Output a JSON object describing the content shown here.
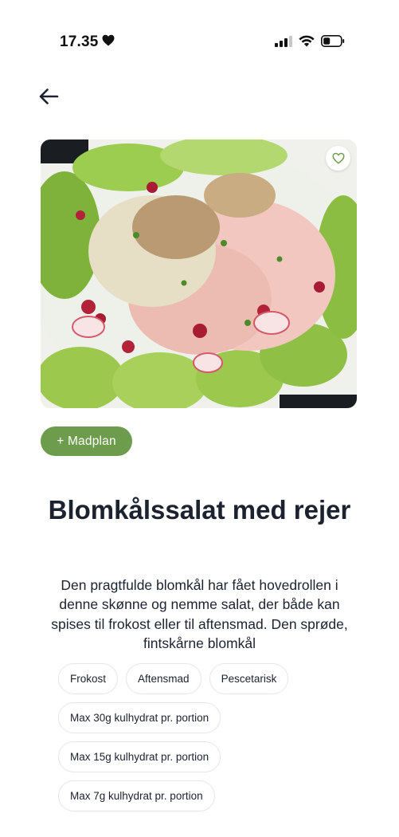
{
  "status_bar": {
    "time": "17.35",
    "heart_icon": "heart-filled-icon",
    "signal_icon": "cellular-signal-icon",
    "wifi_icon": "wifi-icon",
    "battery_icon": "battery-icon"
  },
  "nav": {
    "back_icon": "arrow-left-icon"
  },
  "hero": {
    "favorite_icon": "heart-outline-icon"
  },
  "actions": {
    "meal_plan_label": "+ Madplan",
    "accent_color": "#6d9c4c"
  },
  "recipe": {
    "title": "Blomkålssalat med rejer",
    "description": "Den pragtfulde blomkål har fået hovedrollen i denne skønne og nemme salat, der både kan spises til frokost eller til aftensmad. Den sprøde, fintskårne blomkål",
    "tags": [
      "Frokost",
      "Aftensmad",
      "Pescetarisk",
      "Max 30g kulhydrat pr. portion",
      "Max 15g kulhydrat pr. portion",
      "Max 7g kulhydrat pr. portion"
    ]
  }
}
